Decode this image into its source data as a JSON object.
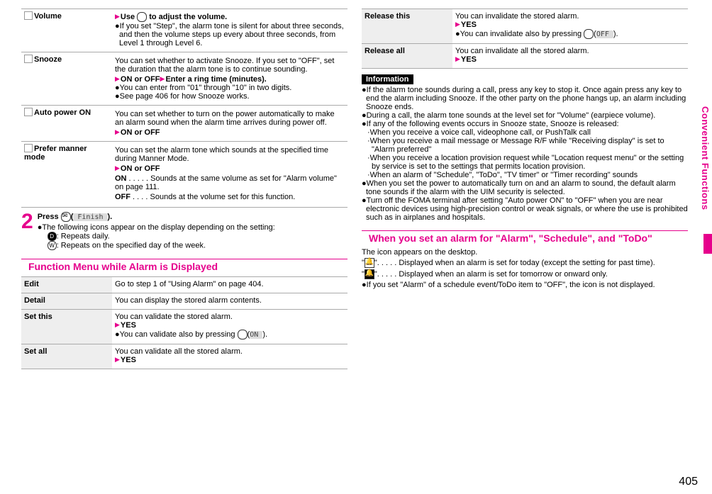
{
  "pageNumber": "405",
  "sideTab": "Convenient Functions",
  "leftTable": {
    "rows": [
      {
        "label": "Volume",
        "hasIcon": true,
        "lines": [
          {
            "prefix": "tri",
            "bold": true,
            "text": "Use ",
            "extra": "circle",
            "tail": " to adjust the volume."
          },
          {
            "prefix": "dot",
            "text": "If you set \"Step\", the alarm tone is silent for about three seconds, and then the volume steps up every about three seconds, from Level 1 through Level 6."
          }
        ]
      },
      {
        "label": "Snooze",
        "hasIcon": true,
        "lines": [
          {
            "text": "You can set whether to activate Snooze. If you set to \"OFF\", set the duration that the alarm tone is to continue sounding."
          },
          {
            "prefix": "tri",
            "bold": true,
            "text": "ON or OFF",
            "tri2": true,
            "bold2": true,
            "text2": "Enter a ring time (minutes)."
          },
          {
            "prefix": "dot",
            "text": "You can enter from \"01\" through \"10\" in two digits."
          },
          {
            "prefix": "dot",
            "text": "See page 406 for how Snooze works."
          }
        ]
      },
      {
        "label": "Auto power ON",
        "hasIcon": true,
        "lines": [
          {
            "text": "You can set whether to turn on the power automatically to make an alarm sound when the alarm time arrives during power off."
          },
          {
            "prefix": "tri",
            "bold": true,
            "text": "ON or OFF"
          }
        ]
      },
      {
        "label": "Prefer manner mode",
        "hasIcon": true,
        "lines": [
          {
            "text": "You can set the alarm tone which sounds at the specified time during Manner Mode."
          },
          {
            "prefix": "tri",
            "bold": true,
            "text": "ON or OFF"
          },
          {
            "bold": true,
            "text": "ON",
            "tail": " . . . . . Sounds at the same volume as set for \"Alarm volume\" on page 111.",
            "hangIndent": true
          },
          {
            "bold": true,
            "text": "OFF",
            "tail": " . . . . Sounds at the volume set for this function."
          }
        ]
      }
    ]
  },
  "step2": {
    "lead": "Press ",
    "mailKey": true,
    "softLabel": "Finish",
    "tailPeriod": ".",
    "note": "The following icons appear on the display depending on the setting:",
    "iconD": ": Repeats daily.",
    "iconW": ": Repeats on the specified day of the week."
  },
  "funcMenuTitle": "Function Menu while Alarm is Displayed",
  "funcTable": {
    "rows": [
      {
        "label": "Edit",
        "lines": [
          {
            "text": "Go to step 1 of \"Using Alarm\" on page 404."
          }
        ]
      },
      {
        "label": "Detail",
        "lines": [
          {
            "text": "You can display the stored alarm contents."
          }
        ]
      },
      {
        "label": "Set this",
        "lines": [
          {
            "text": "You can validate the stored alarm."
          },
          {
            "prefix": "tri",
            "bold": true,
            "text": "YES"
          },
          {
            "prefix": "dot",
            "text": "You can validate also by pressing ",
            "extra": "circlePlain",
            "tail2": "(",
            "soft": "ON",
            "tail3": ")."
          }
        ]
      },
      {
        "label": "Set all",
        "lines": [
          {
            "text": "You can validate all the stored alarm."
          },
          {
            "prefix": "tri",
            "bold": true,
            "text": "YES"
          }
        ]
      }
    ]
  },
  "rightTable": {
    "rows": [
      {
        "label": "Release this",
        "lines": [
          {
            "text": "You can invalidate the stored alarm."
          },
          {
            "prefix": "tri",
            "bold": true,
            "text": "YES"
          },
          {
            "prefix": "dot",
            "text": "You can invalidate also by pressing ",
            "extra": "circlePlain",
            "tail2": "(",
            "soft": "OFF",
            "tail3": ")."
          }
        ]
      },
      {
        "label": "Release all",
        "lines": [
          {
            "text": "You can invalidate all the stored alarm."
          },
          {
            "prefix": "tri",
            "bold": true,
            "text": "YES"
          }
        ]
      }
    ]
  },
  "infoLabel": "Information",
  "infoBullets": [
    "If the alarm tone sounds during a call, press any key to stop it. Once again press any key to end the alarm including Snooze. If the other party on the phone hangs up, an alarm including Snooze ends.",
    "During a call, the alarm tone sounds at the level set for \"Volume\" (earpiece volume).",
    "If any of the following events occurs in Snooze state, Snooze is released:"
  ],
  "infoSubBullets": [
    "When you receive a voice call, videophone call, or PushTalk call",
    "When you receive a mail message or Message R/F while \"Receiving display\" is set to \"Alarm preferred\"",
    "When you receive a location provision request while \"Location request menu\" or the setting by service is set to the settings that permits location provision.",
    "When an alarm of \"Schedule\", \"ToDo\", \"TV timer\" or \"Timer recording\" sounds"
  ],
  "infoBullets2": [
    "When you set the power to automatically turn on and an alarm to sound, the default alarm tone sounds if the alarm with the UIM security is selected.",
    "Turn off the FOMA terminal after setting \"Auto power ON\" to \"OFF\" when you are near electronic devices using high-precision control or weak signals, or where the use is prohibited such as in airplanes and hospitals."
  ],
  "whenSetTitle": "When you set an alarm for \"Alarm\", \"Schedule\", and \"ToDo\"",
  "whenSetLines": [
    "The icon appears on the desktop.",
    "\" 🔔 \". . . . . Displayed when an alarm is set for today (except the setting for past time).",
    "\" 🔔 \". . . . . Displayed when an alarm is set for tomorrow or onward only."
  ],
  "whenSetBullet": "If you set \"Alarm\" of a schedule event/ToDo item to \"OFF\", the icon is not displayed."
}
